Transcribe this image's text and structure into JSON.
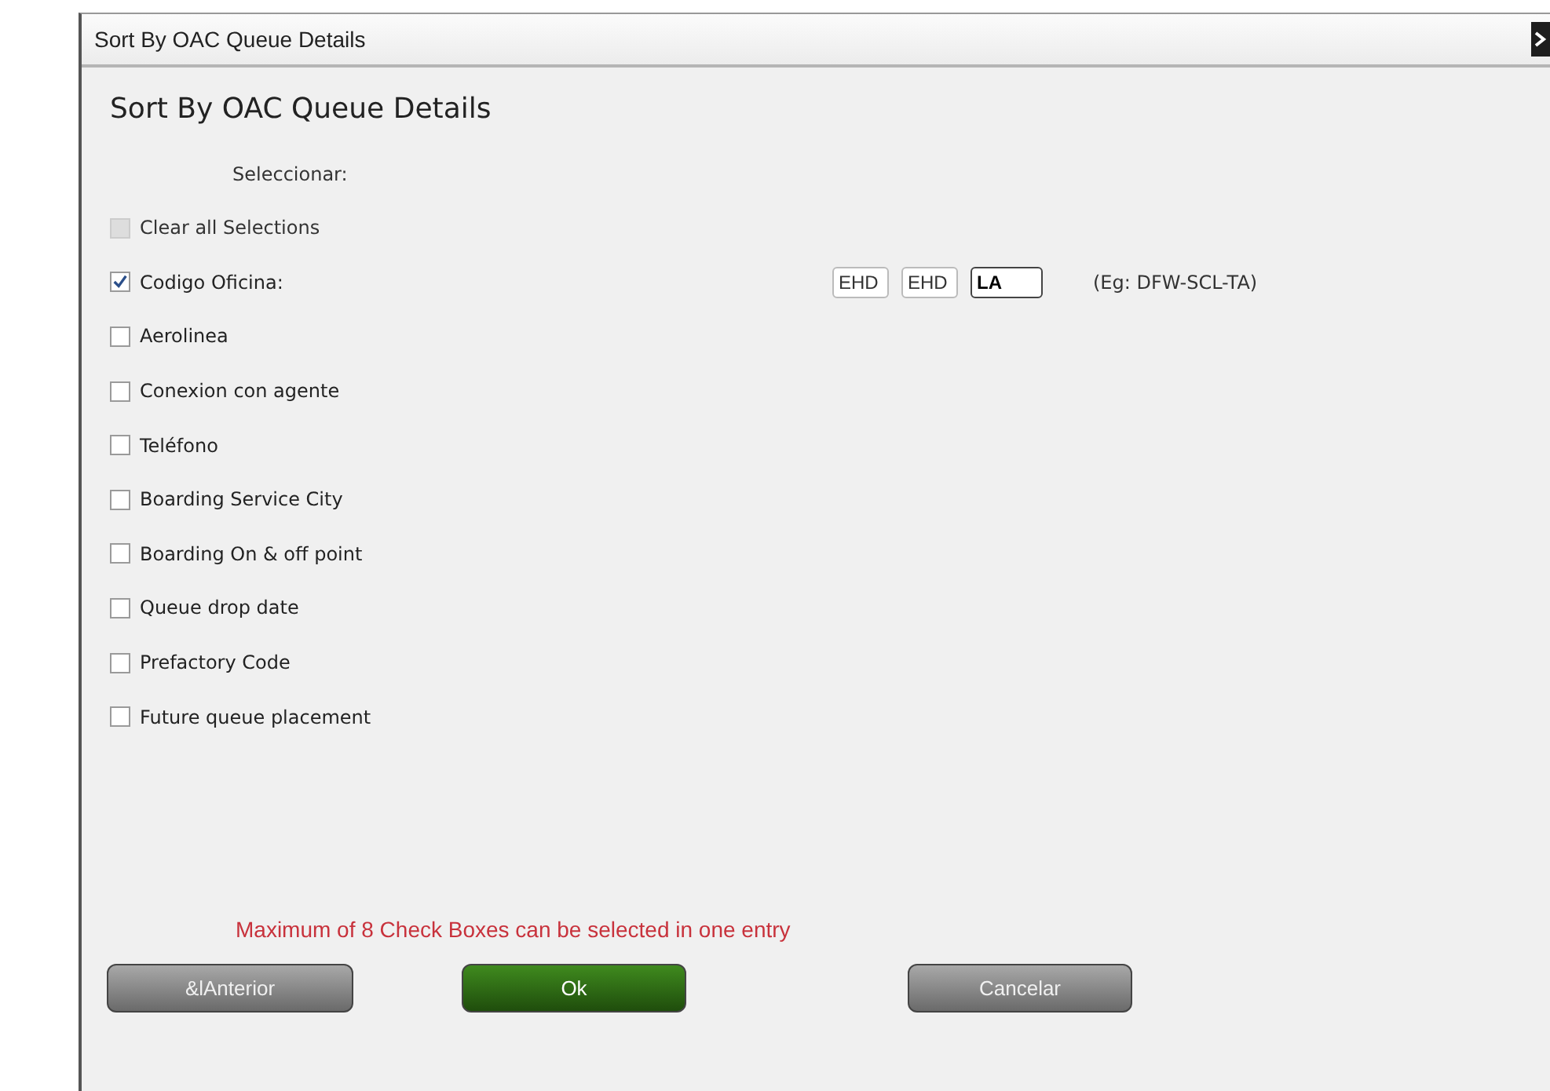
{
  "window": {
    "title": "Sort By OAC Queue Details"
  },
  "heading": "Sort By OAC Queue Details",
  "select_label": "Seleccionar:",
  "options": [
    {
      "label": "Clear all Selections",
      "checked": false,
      "disabled": true
    },
    {
      "label": "Codigo Oficina:",
      "checked": true,
      "disabled": false
    },
    {
      "label": "Aerolinea",
      "checked": false,
      "disabled": false
    },
    {
      "label": "Conexion con agente",
      "checked": false,
      "disabled": false
    },
    {
      "label": "Teléfono",
      "checked": false,
      "disabled": false
    },
    {
      "label": "Boarding Service City",
      "checked": false,
      "disabled": false
    },
    {
      "label": "Boarding On & off point",
      "checked": false,
      "disabled": false
    },
    {
      "label": "Queue drop date",
      "checked": false,
      "disabled": false
    },
    {
      "label": "Prefactory Code",
      "checked": false,
      "disabled": false
    },
    {
      "label": "Future queue placement",
      "checked": false,
      "disabled": false
    }
  ],
  "office_fields": [
    {
      "value": "EHD",
      "focused": false
    },
    {
      "value": "EHD",
      "focused": false
    },
    {
      "value": "LA",
      "focused": true
    }
  ],
  "office_hint": "(Eg: DFW-SCL-TA)",
  "message": "Maximum of  8 Check Boxes can be selected in one entry",
  "buttons": [
    {
      "label": "&lAnterior",
      "kind": "secondary"
    },
    {
      "label": "Ok",
      "kind": "primary"
    },
    {
      "label": "Cancelar",
      "kind": "secondary"
    }
  ]
}
